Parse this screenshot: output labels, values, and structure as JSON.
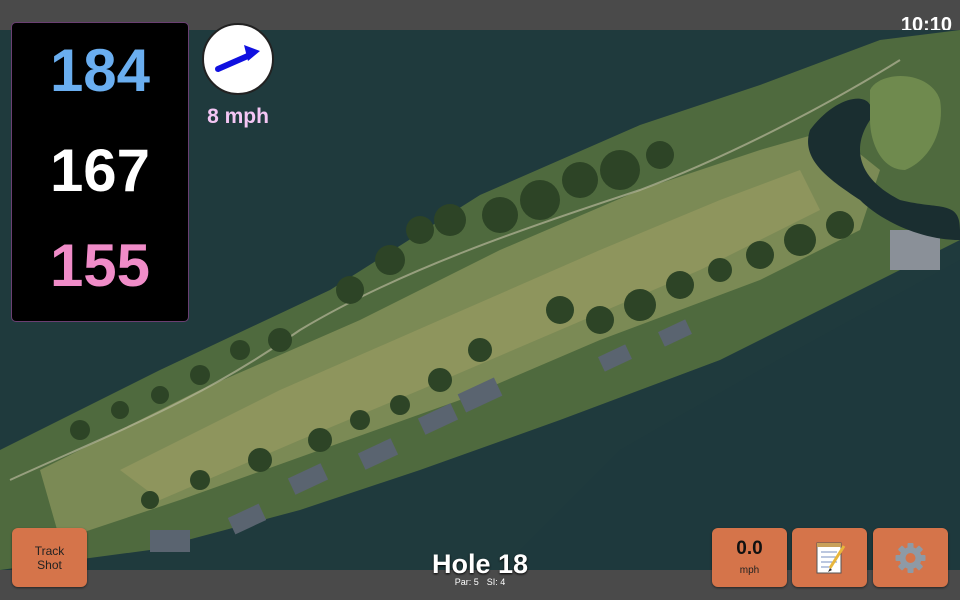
{
  "status": {
    "time": "10:10"
  },
  "yardage": {
    "back": "184",
    "middle": "167",
    "front": "155"
  },
  "wind": {
    "speed": "8 mph",
    "direction_icon": "arrow-icon",
    "arrow_color": "#1010e0"
  },
  "hole": {
    "title": "Hole 18",
    "par": "Par: 5",
    "si": "SI: 4"
  },
  "buttons": {
    "track_shot": "Track\nShot",
    "speed_value": "0.0",
    "speed_unit": "mph",
    "notes_icon": "notepad-icon",
    "settings_icon": "gear-icon"
  },
  "colors": {
    "button": "#d5744a",
    "back_yardage": "#6aaef0",
    "front_yardage": "#f08cc8",
    "wind_text": "#f4c6f4",
    "water": "#1f3a3d"
  }
}
